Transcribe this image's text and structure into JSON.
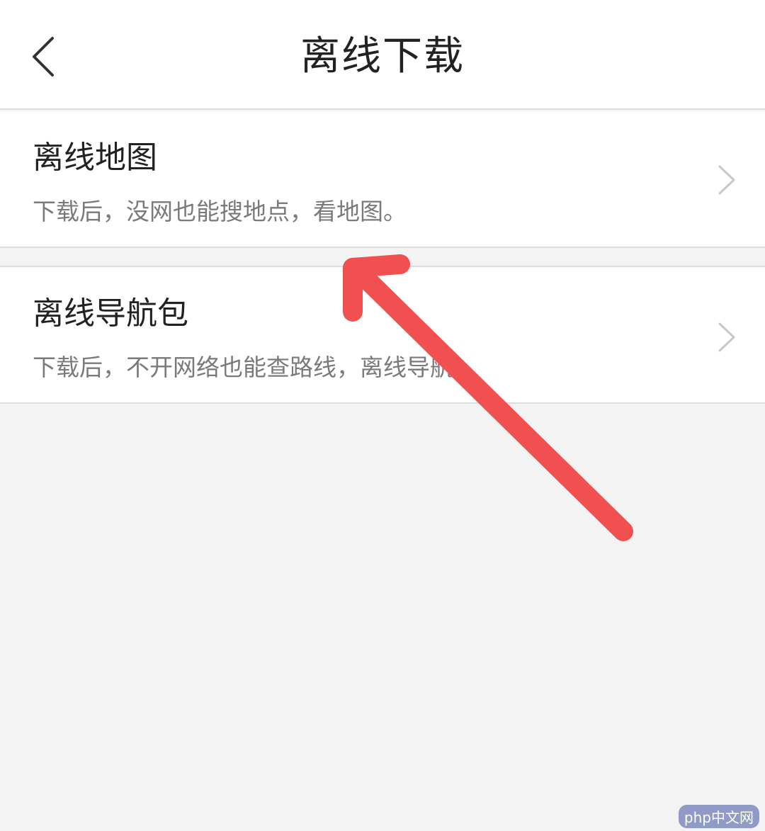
{
  "header": {
    "title": "离线下载",
    "back_icon": "chevron-left-icon"
  },
  "items": [
    {
      "title": "离线地图",
      "description": "下载后，没网也能搜地点，看地图。",
      "icon": "chevron-right-icon"
    },
    {
      "title": "离线导航包",
      "description": "下载后，不开网络也能查路线，离线导航。",
      "icon": "chevron-right-icon"
    }
  ],
  "overlay": {
    "annotation_icon": "red-arrow-icon",
    "annotation_color": "#f05050"
  },
  "watermark": {
    "text": "php中文网"
  },
  "colors": {
    "background": "#f3f3f3",
    "card": "#ffffff",
    "title_text": "#222222",
    "desc_text": "#7a7a7a",
    "divider": "#dcdcdc",
    "chevron": "#c8c8c8"
  }
}
